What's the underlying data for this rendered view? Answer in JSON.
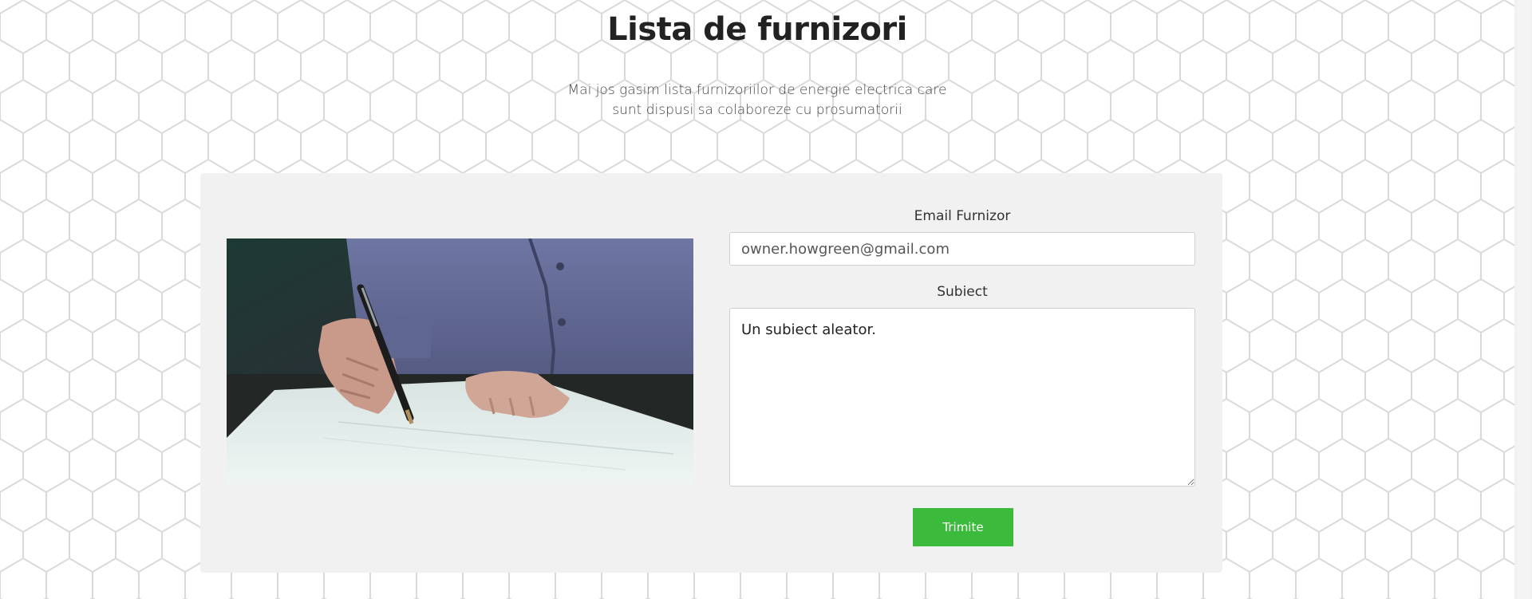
{
  "page": {
    "title": "Lista de furnizori",
    "subtitle": "Mai jos gasim lista furnizoriilor de energie electrica care sunt dispusi sa colaboreze cu prosumatorii"
  },
  "form": {
    "email_label": "Email Furnizor",
    "email_value": "owner.howgreen@gmail.com",
    "subject_label": "Subiect",
    "subject_value": "Un subiect aleator.",
    "submit_label": "Trimite"
  },
  "colors": {
    "accent": "#3cba3c",
    "card_bg": "#f1f1f1",
    "hex_pattern": "#dcdcdc"
  },
  "image": {
    "semantic": "person-signing-document-photo"
  }
}
